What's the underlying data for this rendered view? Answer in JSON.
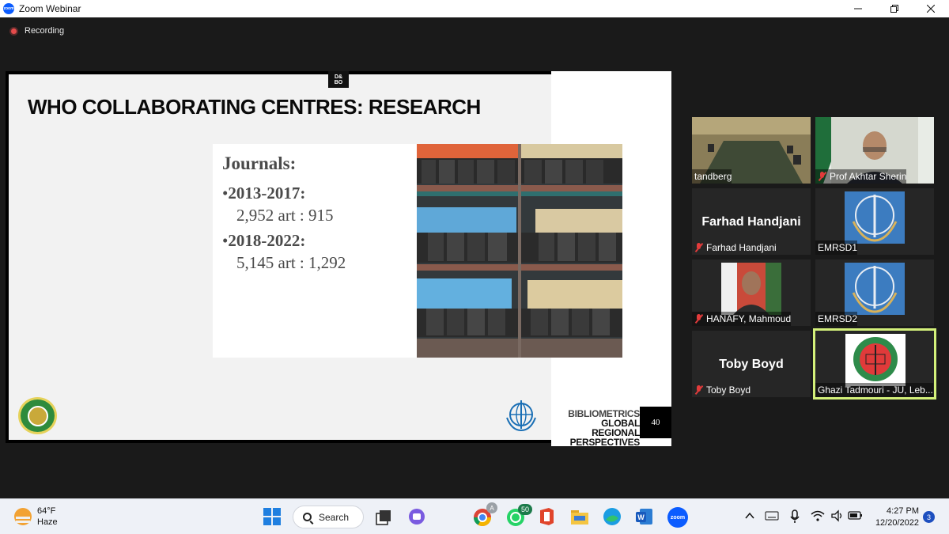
{
  "window": {
    "app_icon": "zoom-icon",
    "title": "Zoom Webinar",
    "controls": [
      "minimize-icon",
      "restore-icon",
      "close-icon"
    ]
  },
  "recording": {
    "label": "Recording",
    "color": "#e54b4b"
  },
  "slide": {
    "tab_label": "D&\nBO",
    "title": "WHO COLLABORATING CENTRES: RESEARCH",
    "journals_heading": "Journals:",
    "periods": [
      {
        "years": "2013-2017:",
        "counts": "2,952 art : 915"
      },
      {
        "years": "2018-2022:",
        "counts": "5,145 art : 1,292"
      }
    ],
    "bullet": "•",
    "footer": {
      "line1": "BIBLIOMETRICS",
      "line2": "GLOBAL REGIONAL",
      "line3": "PERSPECTIVES",
      "page_number": "40"
    }
  },
  "gallery": [
    {
      "name": "tandberg",
      "muted": false,
      "type": "video"
    },
    {
      "name": "Prof Akhtar Sherin",
      "muted": true,
      "type": "video"
    },
    {
      "name": "Farhad Handjani",
      "display_name": "Farhad Handjani",
      "muted": true,
      "type": "name-only"
    },
    {
      "name": "EMRSD1",
      "muted": false,
      "type": "who-logo"
    },
    {
      "name": "HANAFY, Mahmoud",
      "muted": true,
      "type": "video"
    },
    {
      "name": "EMRSD2",
      "muted": false,
      "type": "who-logo"
    },
    {
      "name": "Toby Boyd",
      "display_name": "Toby Boyd",
      "muted": true,
      "type": "name-only"
    },
    {
      "name": "Ghazi Tadmouri - JU, Leb...",
      "muted": false,
      "type": "logo",
      "active_speaker": true
    }
  ],
  "taskbar": {
    "weather": {
      "temp": "64°F",
      "condition": "Haze"
    },
    "search_label": "Search",
    "whatsapp_badge": "50",
    "time": "4:27 PM",
    "date": "12/20/2022",
    "notifications": "3",
    "apps": [
      "windows-start-icon",
      "search-icon",
      "task-view-icon",
      "chat-icon",
      "chrome-icon",
      "whatsapp-icon",
      "office-icon",
      "file-explorer-icon",
      "edge-icon",
      "word-icon",
      "zoom-icon"
    ],
    "tray": [
      "chevron-up-icon",
      "keyboard-icon",
      "microphone-icon",
      "wifi-icon",
      "volume-icon",
      "battery-icon"
    ]
  },
  "colors": {
    "active_speaker_border": "#d3f07a",
    "muted_red": "#e23b3b",
    "zoom_blue": "#0b5cff"
  }
}
